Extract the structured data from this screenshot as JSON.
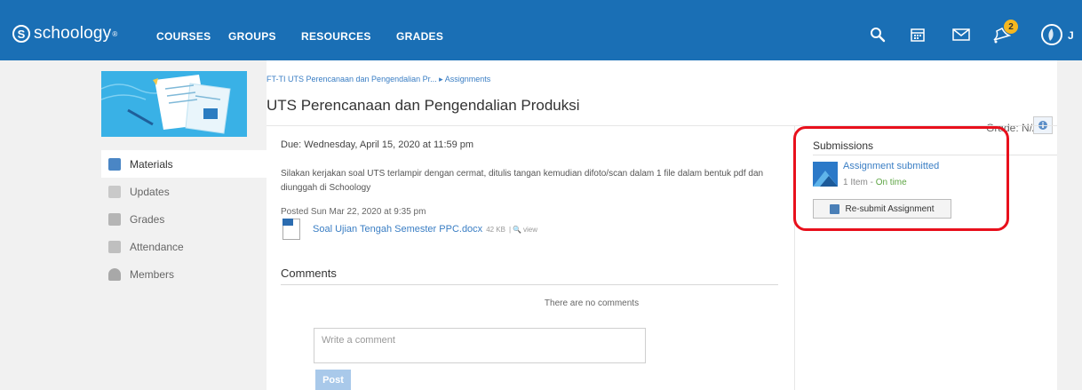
{
  "brand": {
    "logo_text": "schoology",
    "logo_tm": "®"
  },
  "nav": [
    {
      "label": "COURSES"
    },
    {
      "label": "GROUPS"
    },
    {
      "label": "RESOURCES"
    },
    {
      "label": "GRADES"
    }
  ],
  "header": {
    "icons": [
      "search-icon",
      "calendar-icon",
      "mail-icon",
      "notifications-icon"
    ],
    "notification_count": "2",
    "user_initial": "J"
  },
  "sidebar": {
    "items": [
      {
        "label": "Materials",
        "icon": "materials-icon",
        "color": "#4a86c5"
      },
      {
        "label": "Updates",
        "icon": "updates-icon",
        "color": "#c9c9c9"
      },
      {
        "label": "Grades",
        "icon": "grades-icon",
        "color": "#b5b5b5"
      },
      {
        "label": "Attendance",
        "icon": "attendance-icon",
        "color": "#bfbfbf"
      },
      {
        "label": "Members",
        "icon": "members-icon",
        "color": "#a8a8a8"
      }
    ]
  },
  "breadcrumb": {
    "course": "FT-TI UTS Perencanaan dan Pengendalian Pr...",
    "separator": "▸",
    "section": "Assignments"
  },
  "page": {
    "title": "UTS Perencanaan dan Pengendalian Produksi",
    "grade_label": "Grade:",
    "grade_value": "N/A"
  },
  "assignment": {
    "due": "Due: Wednesday, April 15, 2020 at 11:59 pm",
    "description": "Silakan kerjakan soal UTS terlampir dengan cermat, ditulis tangan kemudian difoto/scan dalam 1 file dalam bentuk pdf dan diunggah di Schoology",
    "posted": "Posted Sun Mar 22, 2020 at 9:35 pm",
    "file_name": "Soal Ujian Tengah Semester PPC.docx",
    "file_size": "42 KB",
    "file_separator": "|",
    "file_view": "view"
  },
  "comments": {
    "heading": "Comments",
    "empty_text": "There are no comments",
    "input_placeholder": "Write a comment",
    "post_label": "Post"
  },
  "submissions": {
    "heading": "Submissions",
    "status": "Assignment submitted",
    "item_count": "1 Item",
    "separator": " - ",
    "timing": "On time",
    "resubmit_label": "Re-submit Assignment"
  },
  "colors": {
    "topbar": "#1a6fb5",
    "link": "#3a7ec4",
    "highlight": "#e8101c",
    "ontime": "#5ea544"
  }
}
